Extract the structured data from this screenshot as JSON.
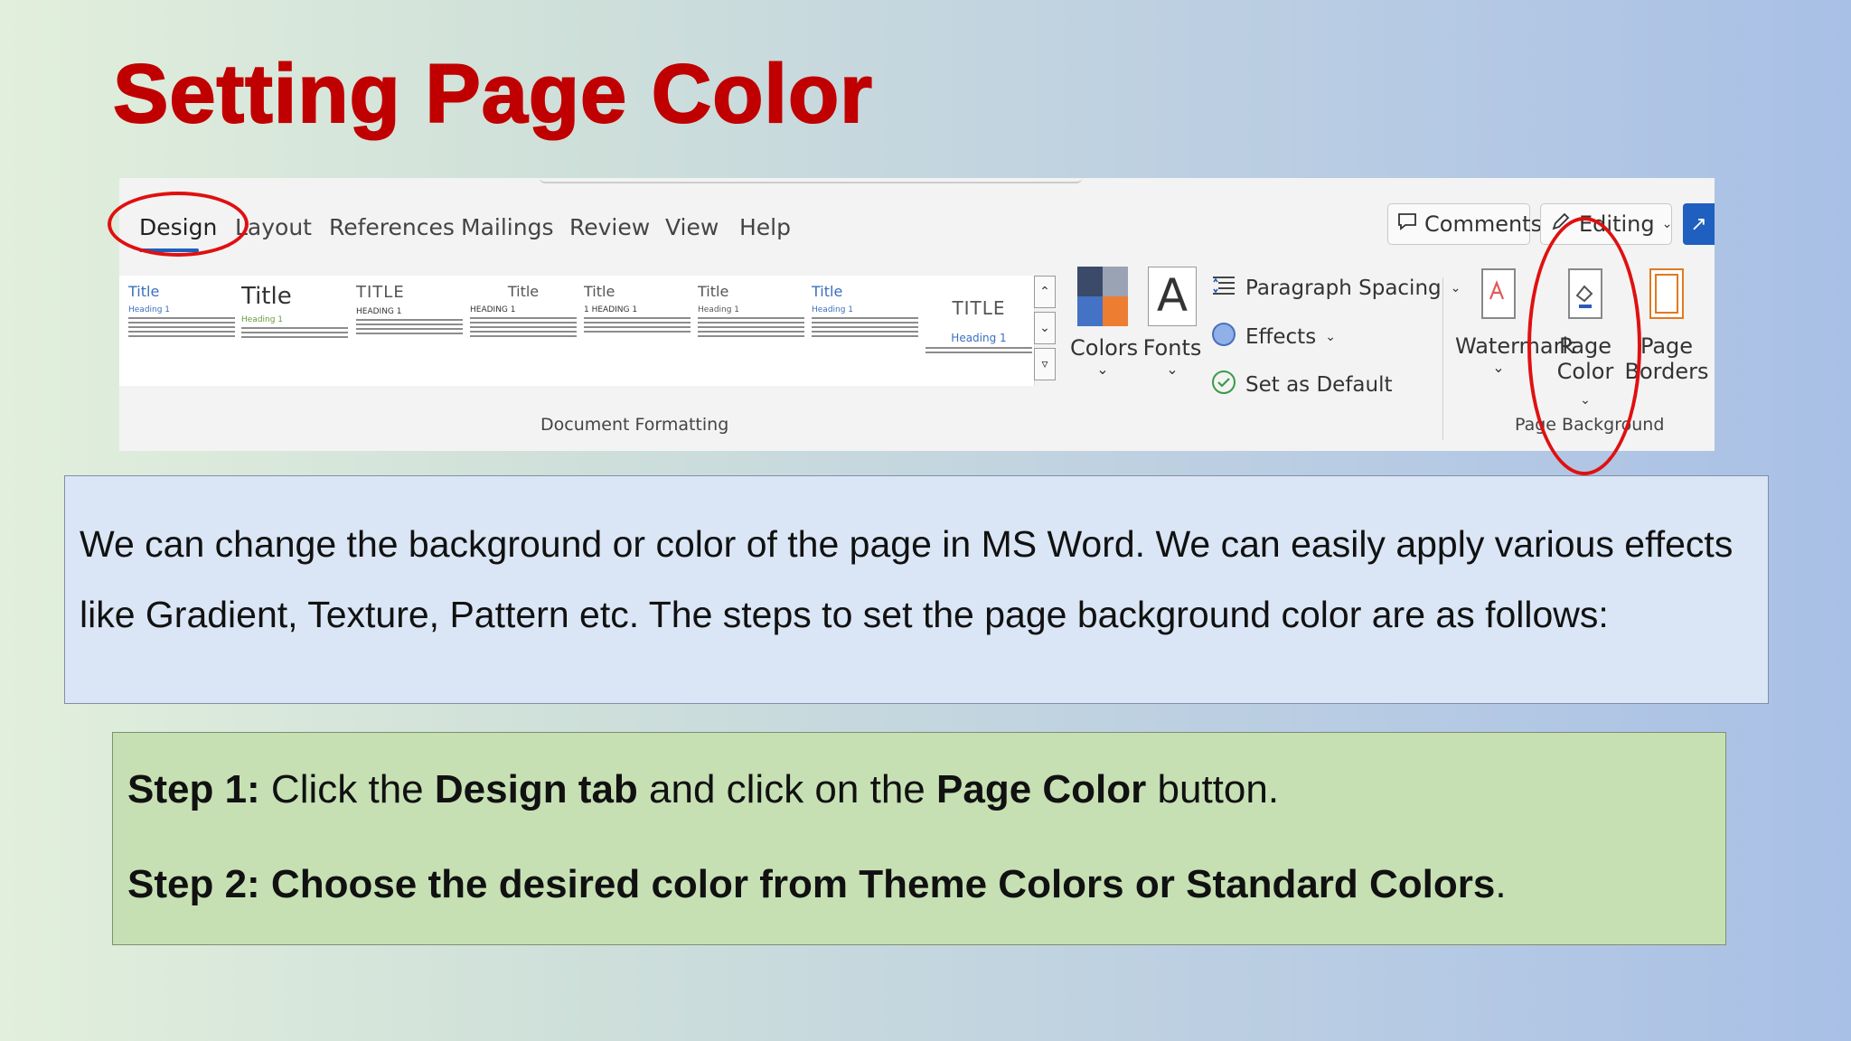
{
  "slide": {
    "title": "Setting Page Color"
  },
  "ribbon": {
    "tabs": [
      {
        "label": "Design",
        "active": true
      },
      {
        "label": "Layout"
      },
      {
        "label": "References"
      },
      {
        "label": "Mailings"
      },
      {
        "label": "Review"
      },
      {
        "label": "View"
      },
      {
        "label": "Help"
      }
    ],
    "comments_label": "Comments",
    "editing_label": "Editing",
    "gallery_titles": [
      "Title",
      "Title",
      "TITLE",
      "Title",
      "Title",
      "Title",
      "Title",
      "TITLE"
    ],
    "gallery_headings": [
      "Heading 1",
      "Heading 1",
      "HEADING 1",
      "HEADING 1",
      "1 HEADING 1",
      "Heading 1",
      "Heading 1",
      "Heading 1"
    ],
    "document_formatting_label": "Document Formatting",
    "colors_label": "Colors",
    "fonts_label": "Fonts",
    "fonts_glyph": "A",
    "paragraph_spacing_label": "Paragraph Spacing",
    "effects_label": "Effects",
    "set_as_default_label": "Set as Default",
    "watermark_label": "Watermark",
    "page_color_label_1": "Page",
    "page_color_label_2": "Color",
    "page_borders_label_1": "Page",
    "page_borders_label_2": "Borders",
    "page_background_label": "Page Background",
    "annotation_color": "#e01010",
    "accent_color": "#1f5fbf",
    "icons": [
      "comment-icon",
      "pencil-icon",
      "share-icon",
      "paragraph-spacing-icon",
      "effects-icon",
      "check-circle-icon",
      "watermark-icon",
      "page-color-icon",
      "page-borders-icon"
    ]
  },
  "description": "We can change the background or color of the page in MS Word. We can easily apply various effects like Gradient, Texture, Pattern etc. The steps to set the page background color are as follows:",
  "steps": {
    "step1_label": "Step 1:",
    "step1_a": " Click the ",
    "step1_b": "Design tab",
    "step1_c": " and click on the ",
    "step1_d": "Page Color",
    "step1_e": " button.",
    "step2_label": "Step 2: Choose the desired color from Theme Colors or Standard Colors",
    "step2_end": "."
  },
  "colors": {
    "title_red": "#c00000",
    "desc_box_bg": "#dae6f5",
    "steps_box_bg": "#c6e0b4"
  }
}
